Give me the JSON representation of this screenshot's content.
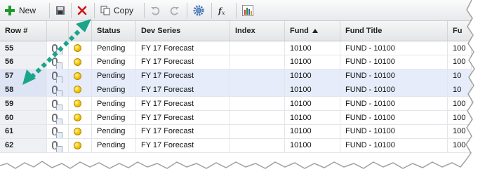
{
  "toolbar": {
    "new_label": "New",
    "copy_label": "Copy"
  },
  "columns": [
    "Row #",
    "",
    "Status",
    "Dev Series",
    "Index",
    "Fund",
    "Fund Title",
    "Fu"
  ],
  "rows": [
    {
      "row": "55",
      "status": "Pending",
      "series": "FY 17 Forecast",
      "index": "",
      "fund": "10100",
      "title": "FUND - 10100",
      "fu": "100"
    },
    {
      "row": "56",
      "status": "Pending",
      "series": "FY 17 Forecast",
      "index": "",
      "fund": "10100",
      "title": "FUND - 10100",
      "fu": "100"
    },
    {
      "row": "57",
      "status": "Pending",
      "series": "FY 17 Forecast",
      "index": "",
      "fund": "10100",
      "title": "FUND - 10100",
      "fu": "10"
    },
    {
      "row": "58",
      "status": "Pending",
      "series": "FY 17 Forecast",
      "index": "",
      "fund": "10100",
      "title": "FUND - 10100",
      "fu": "10"
    },
    {
      "row": "59",
      "status": "Pending",
      "series": "FY 17 Forecast",
      "index": "",
      "fund": "10100",
      "title": "FUND - 10100",
      "fu": "100"
    },
    {
      "row": "60",
      "status": "Pending",
      "series": "FY 17 Forecast",
      "index": "",
      "fund": "10100",
      "title": "FUND - 10100",
      "fu": "100"
    },
    {
      "row": "61",
      "status": "Pending",
      "series": "FY 17 Forecast",
      "index": "",
      "fund": "10100",
      "title": "FUND - 10100",
      "fu": "100"
    },
    {
      "row": "62",
      "status": "Pending",
      "series": "FY 17 Forecast",
      "index": "",
      "fund": "10100",
      "title": "FUND - 10100",
      "fu": "100"
    }
  ],
  "selected_rows": [
    "57",
    "58"
  ],
  "sorted_column": "Fund",
  "colors": {
    "accent_arrow": "#1aa58a",
    "selection": "#e6ecf9",
    "status_pending": "#f2c200",
    "delete_red": "#d01818",
    "add_green": "#1f9a2a"
  },
  "icons": [
    "add-icon",
    "save-icon",
    "delete-icon",
    "copy-icon",
    "undo-icon",
    "redo-icon",
    "settings-icon",
    "function-icon",
    "chart-icon",
    "attachment-icon",
    "status-dot-icon",
    "sort-ascending-icon"
  ]
}
